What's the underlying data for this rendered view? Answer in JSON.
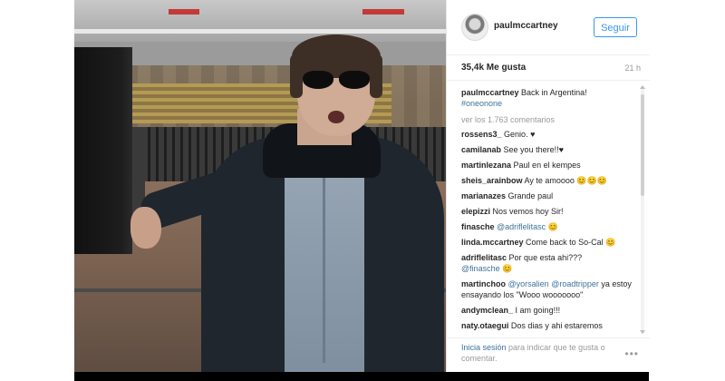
{
  "post": {
    "username": "paulmccartney",
    "follow_label": "Seguir",
    "likes": "35,4k Me gusta",
    "time": "21 h",
    "more": "•••"
  },
  "caption": {
    "user": "paulmccartney",
    "text": "Back in Argentina!",
    "hashtag": "#oneonone"
  },
  "view_all": "ver los 1.763 comentarios",
  "comments": [
    {
      "user": "rossens3_",
      "text": "Genio. ♥"
    },
    {
      "user": "camilanab",
      "text": "See you there!!♥"
    },
    {
      "user": "martinlezana",
      "text": "Paul en el kempes"
    },
    {
      "user": "sheis_arainbow",
      "text": "Ay te amoooo 😊😊😊"
    },
    {
      "user": "marianazes",
      "text": "Grande paul"
    },
    {
      "user": "elepizzi",
      "text": "Nos vemos hoy Sir!"
    },
    {
      "user": "finasche",
      "text": "@adriflelitasc 😊"
    },
    {
      "user": "linda.mccartney",
      "text": "Come back to So-Cal 😊"
    },
    {
      "user": "adriflelitasc",
      "text": "Por que esta ahi???",
      "mention": "@finasche 😊"
    },
    {
      "user": "martinchoo",
      "mention1": "@yorsalien",
      "mention2": "@roadtripper",
      "text": "ya estoy ensayando los \"Wooo wooooooo\""
    },
    {
      "user": "andymclean_",
      "text": "I am going!!!"
    },
    {
      "user": "naty.otaegui",
      "text": "Dos dias y ahi estaremos"
    }
  ],
  "footer": {
    "login": "Inicia sesión",
    "rest": "para indicar que te gusta o comentar."
  }
}
